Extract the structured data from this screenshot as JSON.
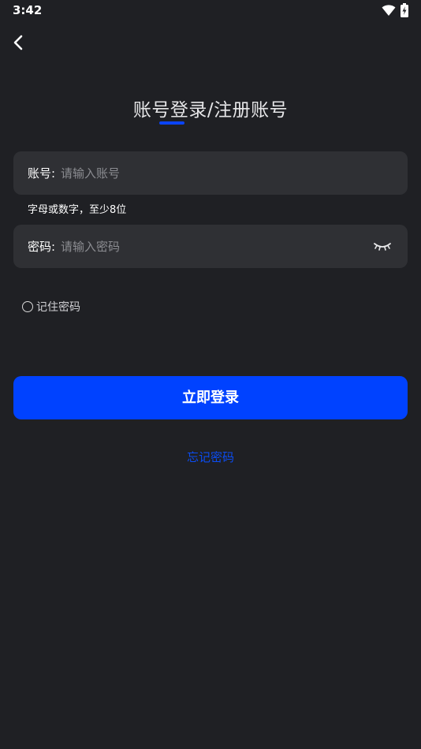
{
  "status_bar": {
    "time": "3:42"
  },
  "title": "账号登录/注册账号",
  "colors": {
    "background": "#1f2024",
    "field_background": "#2f3034",
    "accent": "#0042ff",
    "link": "#0b4cf2"
  },
  "account_field": {
    "label": "账号:",
    "placeholder": "请输入账号",
    "value": "",
    "hint": "字母或数字，至少8位"
  },
  "password_field": {
    "label": "密码:",
    "placeholder": "请输入密码",
    "value": "",
    "toggle_icon": "eye-closed-icon"
  },
  "remember": {
    "label": "记住密码",
    "checked": false
  },
  "login_button": {
    "label": "立即登录"
  },
  "forgot_link": {
    "label": "忘记密码"
  }
}
